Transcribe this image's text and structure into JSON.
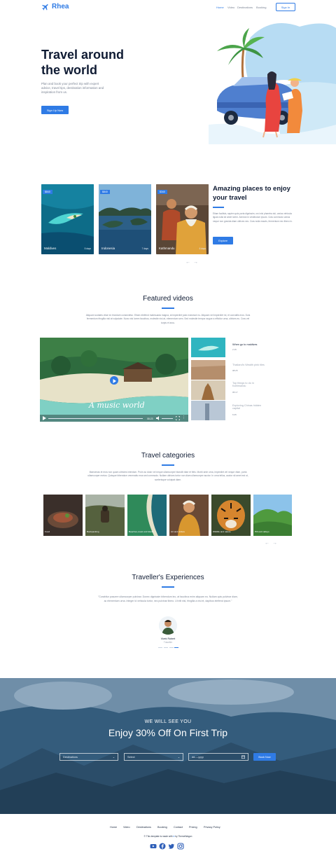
{
  "nav": {
    "brand": "Rhea",
    "links": [
      "Home",
      "Video",
      "Destinations",
      "Booking"
    ],
    "signin": "Sign In"
  },
  "hero": {
    "title_line1": "Travel around",
    "title_line2": "the world",
    "text": "Plan and book your perfect trip with expert advice, travel tips, destination information and inspiration from us.",
    "button": "Sign Up Now"
  },
  "places": {
    "cards": [
      {
        "price": "$840",
        "name": "Maldives",
        "days": "5 days"
      },
      {
        "price": "$840",
        "name": "Indonesia",
        "days": "7 days"
      },
      {
        "price": "$340",
        "name": "Kathmandu",
        "days": "6 days"
      }
    ],
    "title": "Amazing places to enjoy your travel",
    "text": "Etiam facilisis, sapien quis porta dignissim, orci nisi pharetra dui, varius vehicula ligula nulla sit amet lorem. Aenean in vestibulum ipsum. Cras commodo varius neque non gravida diam ultrices nec. Cras nulla mauris, fermentum nec libero in.",
    "button": "Explore",
    "prev": "←",
    "next": "→"
  },
  "videos": {
    "title": "Featured videos",
    "text": "Aliquam sodales vitae ex tincidunt consectetur. Etiam eleifend malesuada magna, at imperdiet justo euismod eu. Aliquam vel imperdiet mi, et convallis eros. Duis fermentum fringilla nisl at vulputate. Nunc nisi lorem faucibus, molestie nisi at, elementum sem. Sed molestie tempor augue a efficitur urna, ultrices eu. Cras vel turpis et arcu.",
    "overlay_text": "A music world",
    "time": "08:23",
    "items": [
      {
        "title": "When go to maldives",
        "time": "2:15"
      },
      {
        "title": "Thailand's Wealth pink tiles",
        "time": "08:25"
      },
      {
        "title": "Top things to do in Kathmandu",
        "time": "05:17"
      },
      {
        "title": "Exploring Chinas hidden capital",
        "time": "6:25"
      }
    ]
  },
  "categories": {
    "title": "Travel categories",
    "text": "Maecenas et eros non quam ultricies interdum. Proin ac dolor vel neque ullamcorper blandit vitae et felis. Morbi ante urna, imperdiet vel neque vitae, porta ullamcorper metus. Quisque bibendum venenatis eros sed commodo. Nullam ultrices tortor non diam ullamcorper auctor. In urna tellus, auctor sit amet est ut, scelerisque volutpat diam.",
    "items": [
      "Food",
      "Backpacking",
      "Beaches,coast and island",
      "Art and culture",
      "Wildlife and nature",
      "Hill and valleys"
    ],
    "prev": "←",
    "next": "→"
  },
  "testimonial": {
    "title": "Traveller's Experiences",
    "quote": "\"Curabitur posuere ullamcorper pulvinar. Donec dignissim bibendum leo, at faucibus enim aliquam eu. Nullam quis pulvinar diam, ac elementum urna. Integer id vehicula tortor, nec pulvinar libero. Ut elit nisl, fringilla a nisi et, dapibus eleifend ipsum.\"",
    "name": "Vivek Robert",
    "role": "Traveller"
  },
  "booking": {
    "subtitle": "WE WILL SEE YOU",
    "title": "Enjoy 30% Off On First Trip",
    "destination_placeholder": "Destinations",
    "select_placeholder": "Select",
    "date_placeholder": "dd----yyyy",
    "button": "Book Now"
  },
  "footer": {
    "links": [
      "Home",
      "Video",
      "Destinations",
      "Booking",
      "Contact",
      "Pricing",
      "Privacy Policy"
    ],
    "copy_prefix": "© This template is made with",
    "copy_suffix": "by ThemeWagon",
    "social": [
      "youtube-icon",
      "facebook-icon",
      "twitter-icon",
      "instagram-icon"
    ]
  },
  "colors": {
    "accent": "#2f7be5",
    "heading": "#0f1b33",
    "muted": "#7b8494"
  }
}
